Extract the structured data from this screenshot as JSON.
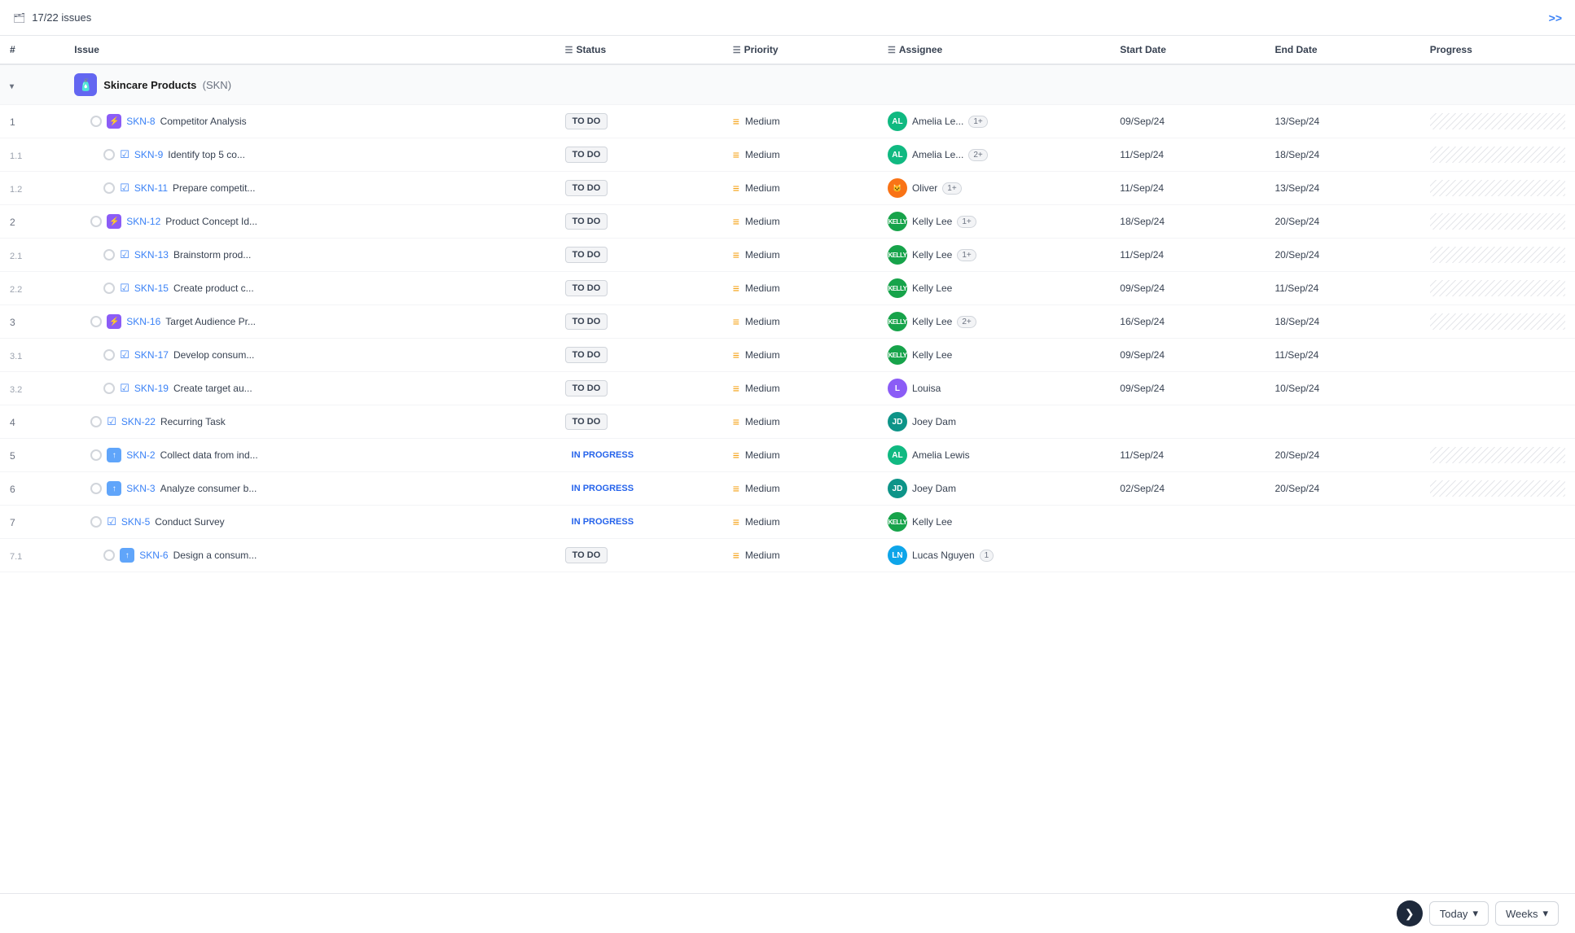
{
  "topbar": {
    "issues_count": "17/22 issues",
    "expand_label": ">>"
  },
  "columns": {
    "num": "#",
    "issue": "Issue",
    "status": "Status",
    "priority": "Priority",
    "assignee": "Assignee",
    "start_date": "Start Date",
    "end_date": "End Date",
    "progress": "Progress"
  },
  "group": {
    "name": "Skincare Products",
    "code": "(SKN)"
  },
  "rows": [
    {
      "num": "1",
      "indent": 1,
      "type": "lightning",
      "code": "SKN-8",
      "title": "Competitor Analysis",
      "status": "TO DO",
      "priority": "Medium",
      "assignee": "Amelia Le...",
      "avatar_type": "al",
      "avatar_text": "AL",
      "extra": "1+",
      "start": "09/Sep/24",
      "end": "13/Sep/24",
      "has_progress": true
    },
    {
      "num": "1.1",
      "indent": 2,
      "type": "check",
      "code": "SKN-9",
      "title": "Identify top 5 co...",
      "status": "TO DO",
      "priority": "Medium",
      "assignee": "Amelia Le...",
      "avatar_type": "al",
      "avatar_text": "AL",
      "extra": "2+",
      "start": "11/Sep/24",
      "end": "18/Sep/24",
      "has_progress": true
    },
    {
      "num": "1.2",
      "indent": 2,
      "type": "check",
      "code": "SKN-11",
      "title": "Prepare competit...",
      "status": "TO DO",
      "priority": "Medium",
      "assignee": "Oliver",
      "avatar_type": "oliver",
      "avatar_text": "🦊",
      "extra": "1+",
      "start": "11/Sep/24",
      "end": "13/Sep/24",
      "has_progress": true
    },
    {
      "num": "2",
      "indent": 1,
      "type": "lightning",
      "code": "SKN-12",
      "title": "Product Concept Id...",
      "status": "TO DO",
      "priority": "Medium",
      "assignee": "Kelly Lee",
      "avatar_type": "kelly",
      "avatar_text": "KELLY",
      "extra": "1+",
      "start": "18/Sep/24",
      "end": "20/Sep/24",
      "has_progress": true
    },
    {
      "num": "2.1",
      "indent": 2,
      "type": "check",
      "code": "SKN-13",
      "title": "Brainstorm prod...",
      "status": "TO DO",
      "priority": "Medium",
      "assignee": "Kelly Lee",
      "avatar_type": "kelly",
      "avatar_text": "KELLY",
      "extra": "1+",
      "start": "11/Sep/24",
      "end": "20/Sep/24",
      "has_progress": true
    },
    {
      "num": "2.2",
      "indent": 2,
      "type": "check",
      "code": "SKN-15",
      "title": "Create product c...",
      "status": "TO DO",
      "priority": "Medium",
      "assignee": "Kelly Lee",
      "avatar_type": "kelly",
      "avatar_text": "KELLY",
      "extra": "",
      "start": "09/Sep/24",
      "end": "11/Sep/24",
      "has_progress": true
    },
    {
      "num": "3",
      "indent": 1,
      "type": "lightning",
      "code": "SKN-16",
      "title": "Target Audience Pr...",
      "status": "TO DO",
      "priority": "Medium",
      "assignee": "Kelly Lee",
      "avatar_type": "kelly",
      "avatar_text": "KELLY",
      "extra": "2+",
      "start": "16/Sep/24",
      "end": "18/Sep/24",
      "has_progress": true
    },
    {
      "num": "3.1",
      "indent": 2,
      "type": "check",
      "code": "SKN-17",
      "title": "Develop consum...",
      "status": "TO DO",
      "priority": "Medium",
      "assignee": "Kelly Lee",
      "avatar_type": "kelly",
      "avatar_text": "KELLY",
      "extra": "",
      "start": "09/Sep/24",
      "end": "11/Sep/24",
      "has_progress": false
    },
    {
      "num": "3.2",
      "indent": 2,
      "type": "check",
      "code": "SKN-19",
      "title": "Create target au...",
      "status": "TO DO",
      "priority": "Medium",
      "assignee": "Louisa",
      "avatar_type": "louisa",
      "avatar_text": "L",
      "extra": "",
      "start": "09/Sep/24",
      "end": "10/Sep/24",
      "has_progress": false
    },
    {
      "num": "4",
      "indent": 1,
      "type": "check",
      "code": "SKN-22",
      "title": "Recurring Task",
      "status": "TO DO",
      "priority": "Medium",
      "assignee": "Joey Dam",
      "avatar_type": "jd",
      "avatar_text": "JD",
      "extra": "",
      "start": "",
      "end": "",
      "has_progress": false
    },
    {
      "num": "5",
      "indent": 1,
      "type": "upload",
      "code": "SKN-2",
      "title": "Collect data from ind...",
      "status": "IN PROGRESS",
      "priority": "Medium",
      "assignee": "Amelia Lewis",
      "avatar_type": "al",
      "avatar_text": "AL",
      "extra": "",
      "start": "11/Sep/24",
      "end": "20/Sep/24",
      "has_progress": true
    },
    {
      "num": "6",
      "indent": 1,
      "type": "upload",
      "code": "SKN-3",
      "title": "Analyze consumer b...",
      "status": "IN PROGRESS",
      "priority": "Medium",
      "assignee": "Joey Dam",
      "avatar_type": "jd",
      "avatar_text": "JD",
      "extra": "",
      "start": "02/Sep/24",
      "end": "20/Sep/24",
      "has_progress": true
    },
    {
      "num": "7",
      "indent": 1,
      "type": "check",
      "code": "SKN-5",
      "title": "Conduct Survey",
      "status": "IN PROGRESS",
      "priority": "Medium",
      "assignee": "Kelly Lee",
      "avatar_type": "kelly",
      "avatar_text": "KELLY",
      "extra": "",
      "start": "",
      "end": "",
      "has_progress": false
    },
    {
      "num": "7.1",
      "indent": 2,
      "type": "upload",
      "code": "SKN-6",
      "title": "Design a consum...",
      "status": "TO DO",
      "priority": "Medium",
      "assignee": "Lucas Nguyen",
      "avatar_type": "lucas",
      "avatar_text": "LN",
      "extra": "1",
      "start": "",
      "end": "",
      "has_progress": false
    }
  ],
  "bottom": {
    "today_label": "Today",
    "weeks_label": "Weeks",
    "nav_icon": "❯"
  }
}
